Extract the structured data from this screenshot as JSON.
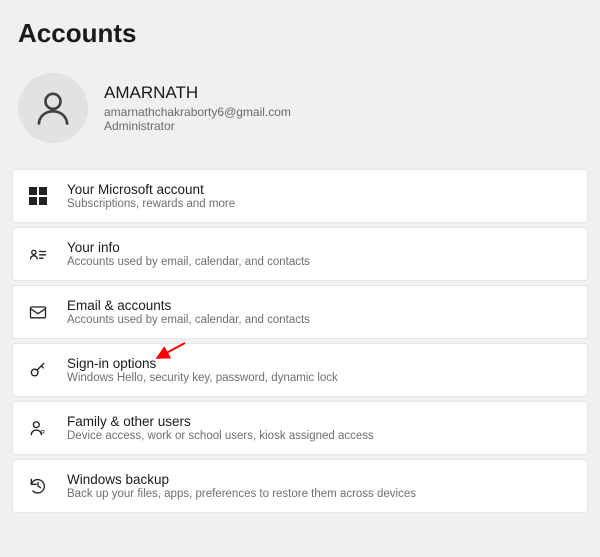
{
  "page_title": "Accounts",
  "user": {
    "name": "AMARNATH",
    "email": "amarnathchakraborty6@gmail.com",
    "role": "Administrator"
  },
  "rows": [
    {
      "title": "Your Microsoft account",
      "subtitle": "Subscriptions, rewards and more"
    },
    {
      "title": "Your info",
      "subtitle": "Accounts used by email, calendar, and contacts"
    },
    {
      "title": "Email & accounts",
      "subtitle": "Accounts used by email, calendar, and contacts"
    },
    {
      "title": "Sign-in options",
      "subtitle": "Windows Hello, security key, password, dynamic lock"
    },
    {
      "title": "Family & other users",
      "subtitle": "Device access, work or school users, kiosk assigned access"
    },
    {
      "title": "Windows backup",
      "subtitle": "Back up your files, apps, preferences to restore them across devices"
    }
  ]
}
